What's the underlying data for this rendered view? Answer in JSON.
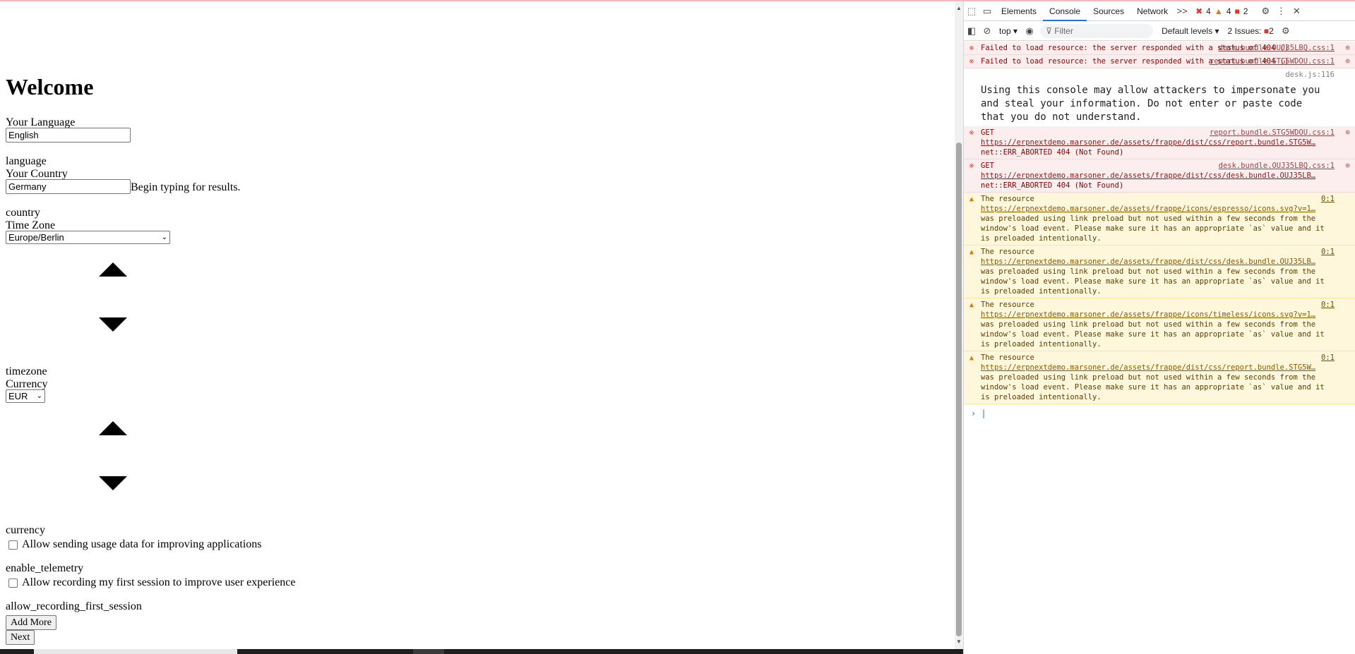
{
  "page": {
    "heading": "Welcome",
    "language_label": "Your Language",
    "language_value": "English",
    "language_field": "language",
    "country_label": "Your Country",
    "country_value": "Germany",
    "country_hint": "Begin typing for results.",
    "country_field": "country",
    "timezone_label": "Time Zone",
    "timezone_value": "Europe/Berlin",
    "timezone_field": "timezone",
    "currency_label": "Currency",
    "currency_value": "EUR",
    "currency_field": "currency",
    "telemetry_label": "Allow sending usage data for improving applications",
    "telemetry_field": "enable_telemetry",
    "recording_label": "Allow recording my first session to improve user experience",
    "recording_field": "allow_recording_first_session",
    "add_more": "Add More",
    "next": "Next"
  },
  "devtools": {
    "tabs": [
      "Elements",
      "Console",
      "Sources",
      "Network"
    ],
    "more": ">>",
    "errors": "4",
    "warnings": "4",
    "issues_count": "2",
    "context": "top",
    "filter_placeholder": "Filter",
    "levels": "Default levels",
    "issues_label": "2 Issues:",
    "issues_badge": "2",
    "messages": [
      {
        "level": "error",
        "text": "Failed to load resource: the server responded with a status of 404 ()",
        "source": "desk.bundle.OUJ35LBQ.css:1"
      },
      {
        "level": "error",
        "text": "Failed to load resource: the server responded with a status of 404 ()",
        "source": "report.bundle.STG5WDOU.css:1"
      },
      {
        "level": "info",
        "text": "Using this console may allow attackers to impersonate you and steal your information. Do not enter or paste code that you do not understand.",
        "source": "desk.js:116"
      },
      {
        "level": "error",
        "text": "GET",
        "link": "https://erpnextdemo.marsoner.de/assets/frappe/dist/css/report.bundle.STG5W…",
        "tail": "net::ERR_ABORTED 404 (Not Found)",
        "source": "report.bundle.STG5WDOU.css:1"
      },
      {
        "level": "error",
        "text": "GET",
        "link": "https://erpnextdemo.marsoner.de/assets/frappe/dist/css/desk.bundle.OUJ35LB…",
        "tail": "net::ERR_ABORTED 404 (Not Found)",
        "source": "desk.bundle.OUJ35LBQ.css:1"
      },
      {
        "level": "warn",
        "text": "The resource",
        "link": "https://erpnextdemo.marsoner.de/assets/frappe/icons/espresso/icons.svg?v=1…",
        "tail": "was preloaded using link preload but not used within a few seconds from the window's load event. Please make sure it has an appropriate `as` value and it is preloaded intentionally.",
        "source": "0:1"
      },
      {
        "level": "warn",
        "text": "The resource",
        "link": "https://erpnextdemo.marsoner.de/assets/frappe/dist/css/desk.bundle.OUJ35LB…",
        "tail": "was preloaded using link preload but not used within a few seconds from the window's load event. Please make sure it has an appropriate `as` value and it is preloaded intentionally.",
        "source": "0:1"
      },
      {
        "level": "warn",
        "text": "The resource",
        "link": "https://erpnextdemo.marsoner.de/assets/frappe/icons/timeless/icons.svg?v=1…",
        "tail": "was preloaded using link preload but not used within a few seconds from the window's load event. Please make sure it has an appropriate `as` value and it is preloaded intentionally.",
        "source": "0:1"
      },
      {
        "level": "warn",
        "text": "The resource",
        "link": "https://erpnextdemo.marsoner.de/assets/frappe/dist/css/report.bundle.STG5W…",
        "tail": "was preloaded using link preload but not used within a few seconds from the window's load event. Please make sure it has an appropriate `as` value and it is preloaded intentionally.",
        "source": "0:1"
      }
    ]
  },
  "colors": {
    "error": "#dc3626",
    "warning": "#e37400",
    "accent": "#1a73e8"
  }
}
